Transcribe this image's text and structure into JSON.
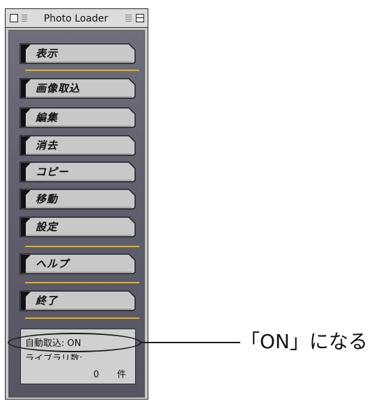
{
  "window": {
    "title": "Photo Loader"
  },
  "menu": [
    {
      "label": "表示"
    },
    {
      "label": "画像取込"
    },
    {
      "label": "編集"
    },
    {
      "label": "消去"
    },
    {
      "label": "コピー"
    },
    {
      "label": "移動"
    },
    {
      "label": "設定"
    },
    {
      "label": "ヘルプ"
    },
    {
      "label": "終了"
    }
  ],
  "status": {
    "auto_import": "自動取込: ON",
    "library_count_label": "ライブラリ数:",
    "count_value": "0",
    "count_unit": "件"
  },
  "callout": {
    "text": "「ON」になる"
  },
  "colors": {
    "separator": "#e6b213",
    "panel": "#5f5f6d",
    "button_face": "#c8c8c8"
  }
}
